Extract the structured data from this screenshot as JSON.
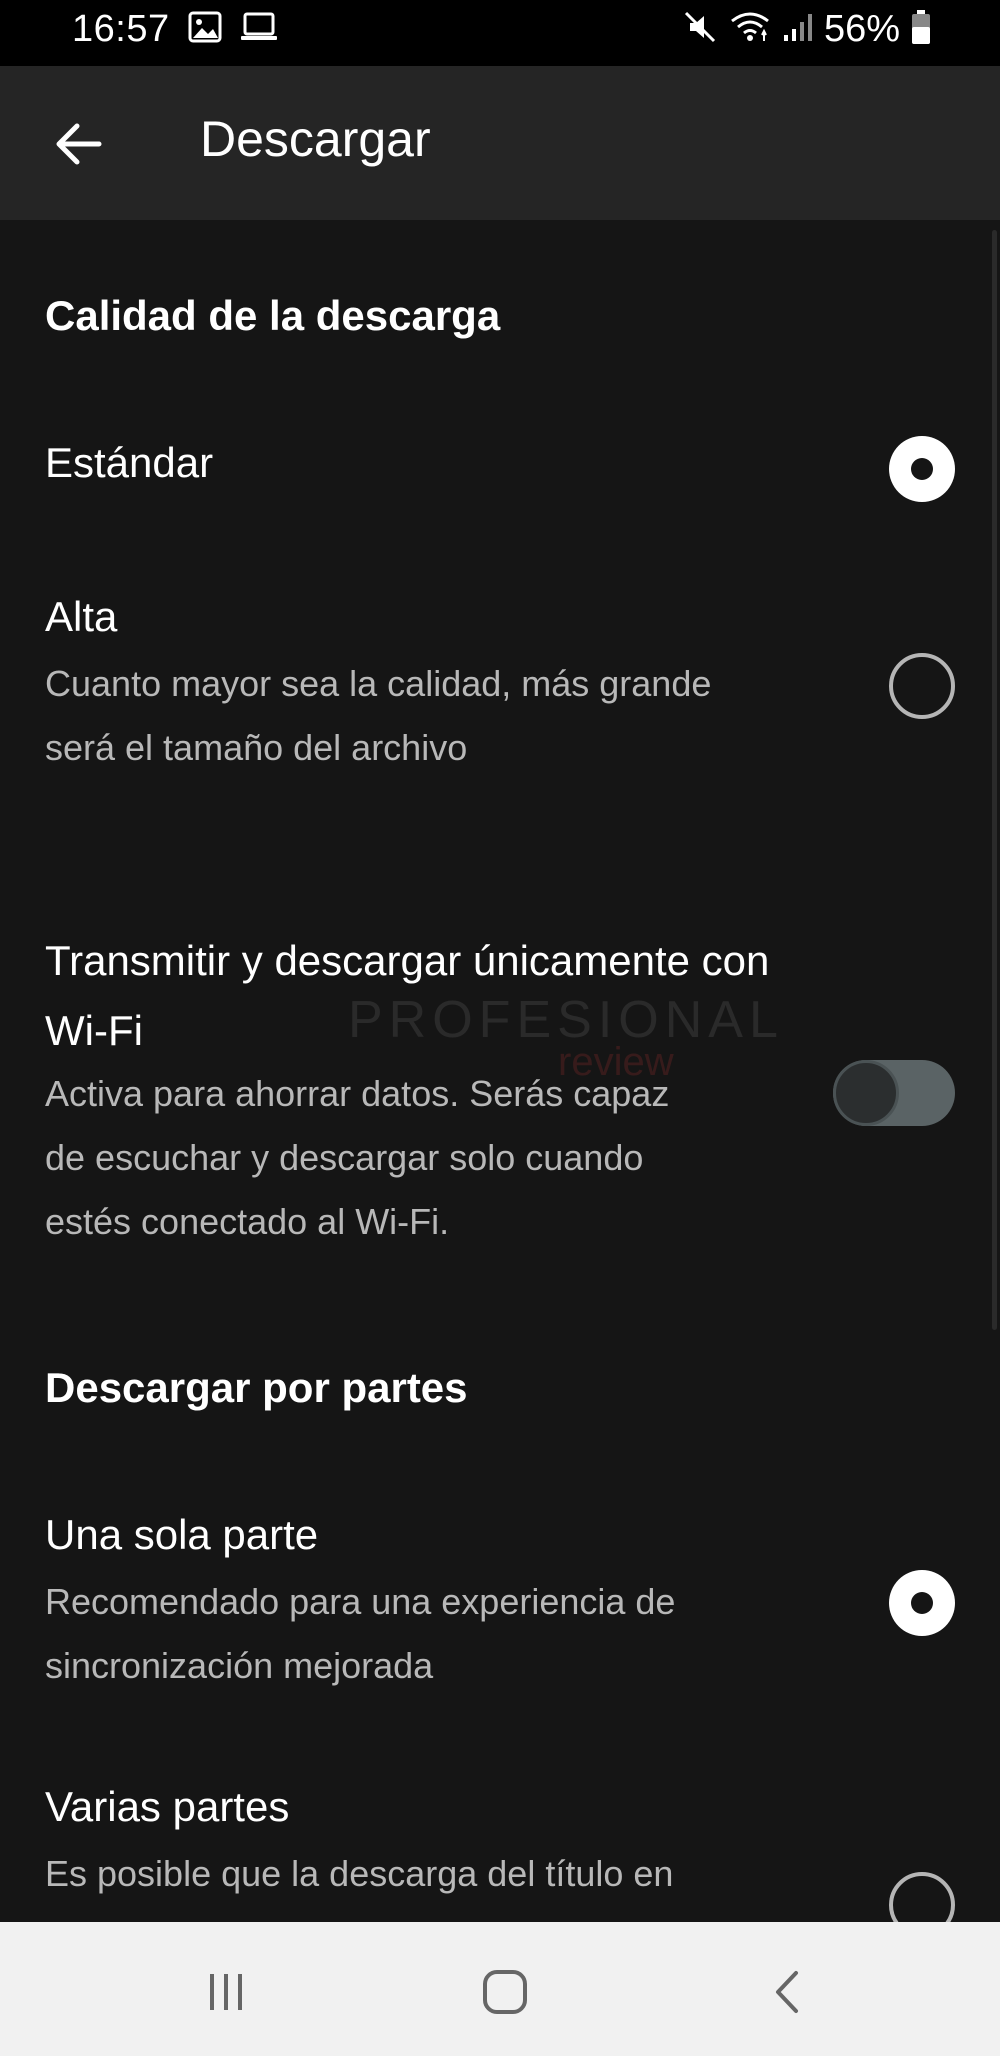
{
  "status_bar": {
    "time": "16:57",
    "left_icons": [
      "image-icon",
      "laptop-icon"
    ],
    "right_icons": [
      "mute-icon",
      "wifi-icon",
      "signal-icon",
      "battery-icon"
    ],
    "battery": "56%"
  },
  "app_bar": {
    "back_icon": "back-arrow-icon",
    "title": "Descargar"
  },
  "sections": {
    "quality": {
      "header": "Calidad de la descarga",
      "options": [
        {
          "title": "Estándar",
          "selected": true
        },
        {
          "title": "Alta",
          "description_line1": "Cuanto mayor sea la calidad, más grande",
          "description_line2": "será el tamaño del archivo",
          "selected": false
        }
      ]
    },
    "wifi": {
      "title_line1": "Transmitir y descargar únicamente con",
      "title_line2": "Wi-Fi",
      "description_line1": "Activa para ahorrar datos. Serás capaz",
      "description_line2": "de escuchar y descargar solo cuando",
      "description_line3": "estés conectado al Wi-Fi.",
      "enabled": false
    },
    "parts": {
      "header": "Descargar por partes",
      "options": [
        {
          "title": "Una sola parte",
          "description_line1": "Recomendado para una experiencia de",
          "description_line2": "sincronización mejorada",
          "selected": true
        },
        {
          "title": "Varias partes",
          "description_line1": "Es posible que la descarga del título en",
          "selected": false
        }
      ]
    }
  },
  "watermark": {
    "top": "PROFESIONAL",
    "bottom": "review"
  },
  "nav_bar": {
    "icons": [
      "recent-apps-icon",
      "home-icon",
      "back-icon"
    ]
  },
  "colors": {
    "background": "#151515",
    "app_bar": "#252525",
    "secondary_text": "#b8b8b8",
    "nav_bar": "#f1f1f1"
  }
}
